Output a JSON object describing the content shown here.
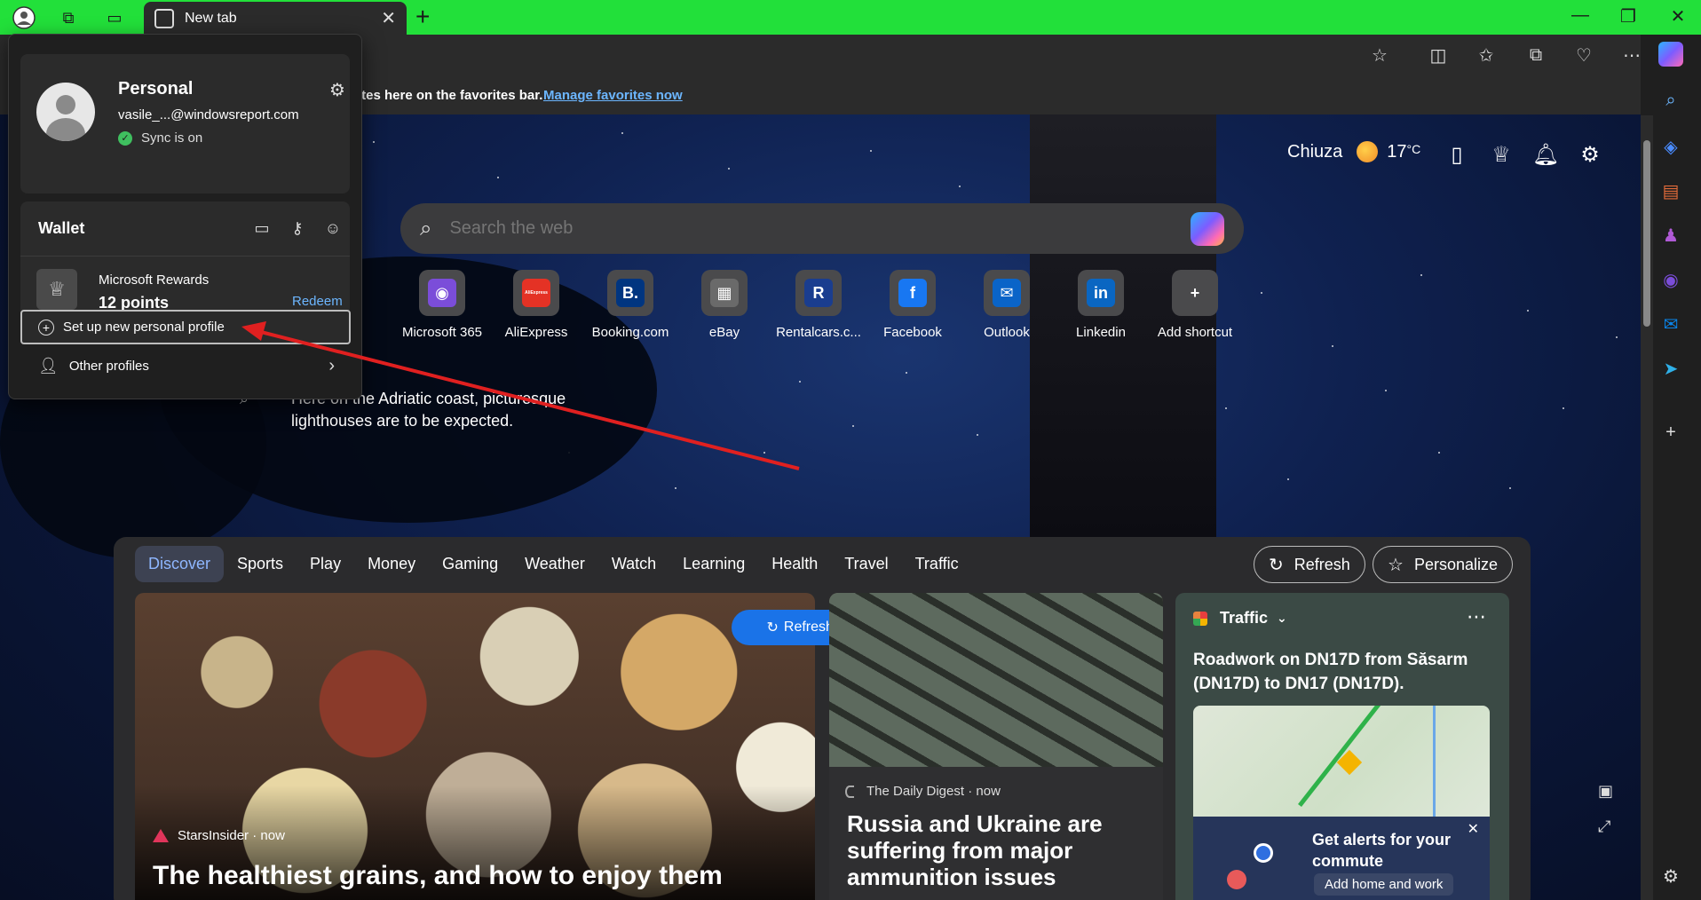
{
  "window": {
    "tab_title": "New tab"
  },
  "favorites_bar": {
    "text": "ites here on the favorites bar.",
    "link": "Manage favorites now"
  },
  "profile_menu": {
    "name": "Personal",
    "email": "vasile_...@windowsreport.com",
    "sync_status": "Sync is on",
    "wallet_label": "Wallet",
    "rewards_title": "Microsoft Rewards",
    "rewards_points": "12 points",
    "redeem_label": "Redeem",
    "setup_profile_label": "Set up new personal profile",
    "other_profiles_label": "Other profiles"
  },
  "ntp": {
    "location": "Chiuza",
    "temperature": "17",
    "temp_unit": "°C",
    "search_placeholder": "Search the web",
    "image_caption": "Here on the Adriatic coast, picturesque lighthouses are to be expected.",
    "shortcuts": [
      {
        "label": "Microsoft 365",
        "color": "#7b4dd9",
        "glyph": "◉"
      },
      {
        "label": "AliExpress",
        "color": "#e43225",
        "glyph": "AliExpress"
      },
      {
        "label": "Booking.com",
        "color": "#003580",
        "glyph": "B."
      },
      {
        "label": "eBay",
        "color": "#6a6a6a",
        "glyph": "▦"
      },
      {
        "label": "Rentalcars.c...",
        "color": "#1a3d8f",
        "glyph": "R"
      },
      {
        "label": "Facebook",
        "color": "#1877f2",
        "glyph": "f"
      },
      {
        "label": "Outlook",
        "color": "#0a64c8",
        "glyph": "✉"
      },
      {
        "label": "Linkedin",
        "color": "#0a66c2",
        "glyph": "in"
      },
      {
        "label": "Add shortcut",
        "color": "#4a4a4c",
        "glyph": "+"
      }
    ]
  },
  "feed": {
    "tabs": [
      "Discover",
      "Sports",
      "Play",
      "Money",
      "Gaming",
      "Weather",
      "Watch",
      "Learning",
      "Health",
      "Travel",
      "Traffic"
    ],
    "refresh_label": "Refresh",
    "personalize_label": "Personalize",
    "refresh_stories_label": "Refresh stories",
    "card1": {
      "source": "StarsInsider",
      "time": "now",
      "title": "The healthiest grains, and how to enjoy them"
    },
    "card2": {
      "source": "The Daily Digest",
      "time": "now",
      "title": "Russia and Ukraine are suffering from major ammunition issues"
    },
    "traffic": {
      "header": "Traffic",
      "headline": "Roadwork on DN17D from Săsarm (DN17D) to DN17 (DN17D).",
      "alert_title": "Get alerts for your commute",
      "alert_button": "Add home and work"
    }
  },
  "colors": {
    "titlebar": "#22e03a",
    "accent_link": "#6cb6ff",
    "refresh_pill": "#1a73e8",
    "annotation_arrow": "#e02020"
  }
}
